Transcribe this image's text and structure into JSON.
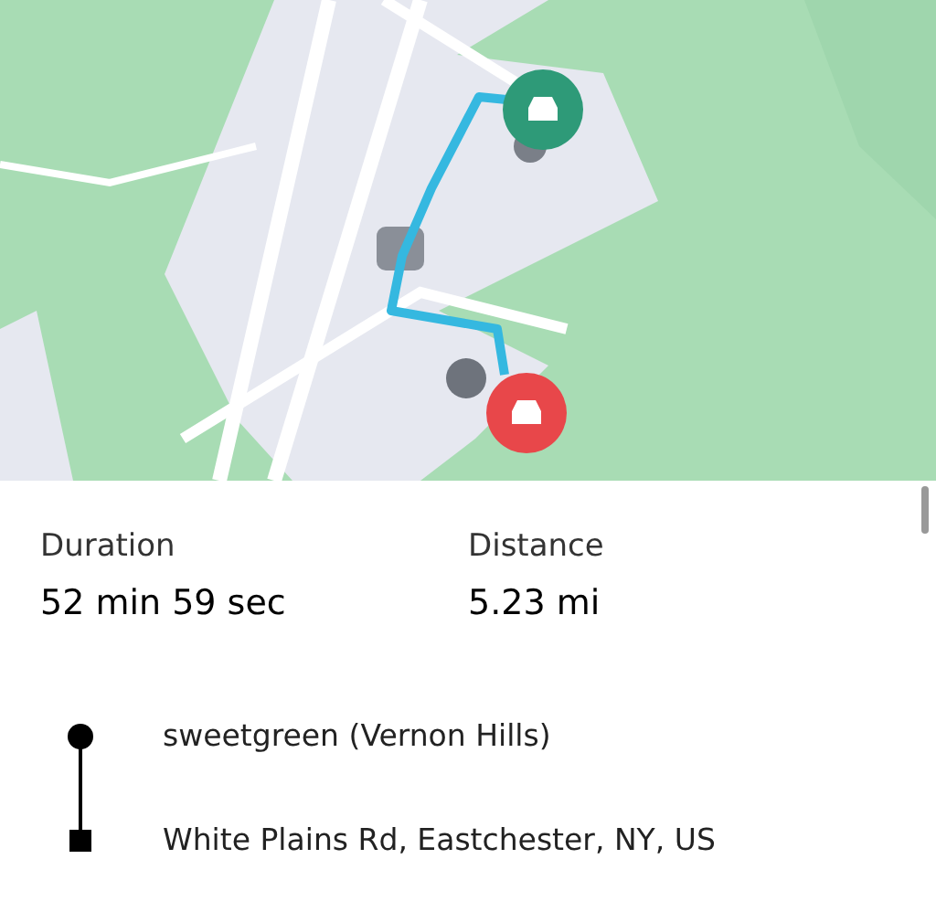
{
  "map": {
    "markers": [
      {
        "color": "#2e9a78"
      },
      {
        "color": "#e8474a"
      }
    ]
  },
  "trip": {
    "stats": [
      {
        "label": "Duration",
        "value": "52 min 59 sec"
      },
      {
        "label": "Distance",
        "value": "5.23 mi"
      }
    ],
    "stops": [
      {
        "kind": "start",
        "address": "sweetgreen (Vernon Hills)"
      },
      {
        "kind": "end",
        "address": "White Plains Rd, Eastchester, NY, US"
      }
    ]
  }
}
